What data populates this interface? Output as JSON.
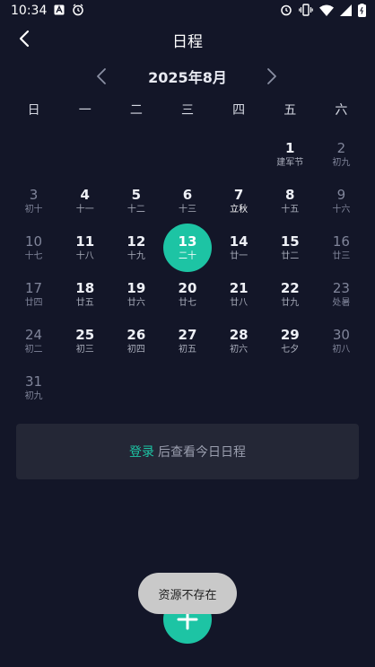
{
  "status_bar": {
    "time": "10:34"
  },
  "header": {
    "title": "日程"
  },
  "month_nav": {
    "label": "2025年8月"
  },
  "weekdays": [
    "日",
    "一",
    "二",
    "三",
    "四",
    "五",
    "六"
  ],
  "days": [
    {
      "num": "",
      "lunar": ""
    },
    {
      "num": "",
      "lunar": ""
    },
    {
      "num": "",
      "lunar": ""
    },
    {
      "num": "",
      "lunar": ""
    },
    {
      "num": "",
      "lunar": ""
    },
    {
      "num": "1",
      "lunar": "建军节"
    },
    {
      "num": "2",
      "lunar": "初九"
    },
    {
      "num": "3",
      "lunar": "初十"
    },
    {
      "num": "4",
      "lunar": "十一"
    },
    {
      "num": "5",
      "lunar": "十二"
    },
    {
      "num": "6",
      "lunar": "十三"
    },
    {
      "num": "7",
      "lunar": "立秋"
    },
    {
      "num": "8",
      "lunar": "十五"
    },
    {
      "num": "9",
      "lunar": "十六"
    },
    {
      "num": "10",
      "lunar": "十七"
    },
    {
      "num": "11",
      "lunar": "十八"
    },
    {
      "num": "12",
      "lunar": "十九"
    },
    {
      "num": "13",
      "lunar": "二十"
    },
    {
      "num": "14",
      "lunar": "廿一"
    },
    {
      "num": "15",
      "lunar": "廿二"
    },
    {
      "num": "16",
      "lunar": "廿三"
    },
    {
      "num": "17",
      "lunar": "廿四"
    },
    {
      "num": "18",
      "lunar": "廿五"
    },
    {
      "num": "19",
      "lunar": "廿六"
    },
    {
      "num": "20",
      "lunar": "廿七"
    },
    {
      "num": "21",
      "lunar": "廿八"
    },
    {
      "num": "22",
      "lunar": "廿九"
    },
    {
      "num": "23",
      "lunar": "处暑"
    },
    {
      "num": "24",
      "lunar": "初二"
    },
    {
      "num": "25",
      "lunar": "初三"
    },
    {
      "num": "26",
      "lunar": "初四"
    },
    {
      "num": "27",
      "lunar": "初五"
    },
    {
      "num": "28",
      "lunar": "初六"
    },
    {
      "num": "29",
      "lunar": "七夕"
    },
    {
      "num": "30",
      "lunar": "初八"
    },
    {
      "num": "31",
      "lunar": "初九"
    }
  ],
  "login": {
    "link": "登录",
    "rest": "后查看今日日程"
  },
  "toast": {
    "text": "资源不存在"
  },
  "colors": {
    "accent": "#1dc4a4",
    "background": "#131628",
    "panel": "#242736"
  }
}
